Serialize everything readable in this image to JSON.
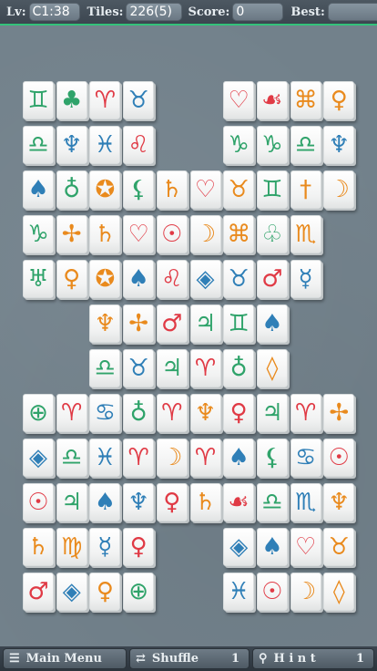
{
  "header": {
    "level_label": "Lv:",
    "level_value": "C1:38",
    "tiles_label": "Tiles:",
    "tiles_value": "226(5)",
    "score_label": "Score:",
    "score_value": "0",
    "best_label": "Best:",
    "best_value": ""
  },
  "footer": {
    "menu_label": "Main Menu",
    "shuffle_label": "Shuffle",
    "shuffle_count": "1",
    "hint_label": "H i n t",
    "hint_count": "1"
  },
  "icons": {
    "menu": "list-icon",
    "shuffle": "shuffle-icon",
    "hint": "magnifier-icon"
  },
  "colors": {
    "accent_bar": "#33c27a",
    "green": "#2fa36a",
    "blue": "#2f7fb7",
    "red": "#e03a45",
    "orange": "#e98a1d"
  },
  "tiles": [
    {
      "row": 0,
      "col": 0,
      "g": "♊",
      "c": "green"
    },
    {
      "row": 0,
      "col": 1,
      "g": "♣",
      "c": "green"
    },
    {
      "row": 0,
      "col": 2,
      "g": "♈",
      "c": "red"
    },
    {
      "row": 0,
      "col": 3,
      "g": "♉",
      "c": "blue"
    },
    {
      "row": 0,
      "col": 6,
      "g": "♡",
      "c": "red"
    },
    {
      "row": 0,
      "col": 7,
      "g": "☙",
      "c": "red"
    },
    {
      "row": 0,
      "col": 8,
      "g": "⌘",
      "c": "orange"
    },
    {
      "row": 0,
      "col": 9,
      "g": "♀",
      "c": "orange"
    },
    {
      "row": 1,
      "col": 0,
      "g": "♎",
      "c": "green"
    },
    {
      "row": 1,
      "col": 1,
      "g": "♆",
      "c": "blue"
    },
    {
      "row": 1,
      "col": 2,
      "g": "♓",
      "c": "blue"
    },
    {
      "row": 1,
      "col": 3,
      "g": "♌",
      "c": "red"
    },
    {
      "row": 1,
      "col": 6,
      "g": "♑",
      "c": "green"
    },
    {
      "row": 1,
      "col": 7,
      "g": "♑",
      "c": "green"
    },
    {
      "row": 1,
      "col": 8,
      "g": "♎",
      "c": "green"
    },
    {
      "row": 1,
      "col": 9,
      "g": "♆",
      "c": "blue"
    },
    {
      "row": 2,
      "col": 0,
      "g": "♠",
      "c": "blue"
    },
    {
      "row": 2,
      "col": 1,
      "g": "♁",
      "c": "green"
    },
    {
      "row": 2,
      "col": 2,
      "g": "✪",
      "c": "orange"
    },
    {
      "row": 2,
      "col": 3,
      "g": "⚸",
      "c": "green"
    },
    {
      "row": 2,
      "col": 4,
      "g": "♄",
      "c": "orange"
    },
    {
      "row": 2,
      "col": 5,
      "g": "♡",
      "c": "red"
    },
    {
      "row": 2,
      "col": 6,
      "g": "♉",
      "c": "orange"
    },
    {
      "row": 2,
      "col": 7,
      "g": "♊",
      "c": "green"
    },
    {
      "row": 2,
      "col": 8,
      "g": "†",
      "c": "orange"
    },
    {
      "row": 2,
      "col": 9,
      "g": "☽",
      "c": "orange"
    },
    {
      "row": 3,
      "col": 0,
      "g": "♑",
      "c": "green"
    },
    {
      "row": 3,
      "col": 1,
      "g": "✢",
      "c": "orange"
    },
    {
      "row": 3,
      "col": 2,
      "g": "♄",
      "c": "orange"
    },
    {
      "row": 3,
      "col": 3,
      "g": "♡",
      "c": "red"
    },
    {
      "row": 3,
      "col": 4,
      "g": "☉",
      "c": "red"
    },
    {
      "row": 3,
      "col": 5,
      "g": "☽",
      "c": "orange"
    },
    {
      "row": 3,
      "col": 6,
      "g": "⌘",
      "c": "orange"
    },
    {
      "row": 3,
      "col": 7,
      "g": "♧",
      "c": "green"
    },
    {
      "row": 3,
      "col": 8,
      "g": "♏",
      "c": "orange"
    },
    {
      "row": 4,
      "col": 0,
      "g": "♅",
      "c": "green"
    },
    {
      "row": 4,
      "col": 1,
      "g": "♀",
      "c": "orange"
    },
    {
      "row": 4,
      "col": 2,
      "g": "✪",
      "c": "orange"
    },
    {
      "row": 4,
      "col": 3,
      "g": "♠",
      "c": "blue"
    },
    {
      "row": 4,
      "col": 4,
      "g": "♌",
      "c": "red"
    },
    {
      "row": 4,
      "col": 5,
      "g": "◈",
      "c": "blue"
    },
    {
      "row": 4,
      "col": 6,
      "g": "♉",
      "c": "blue"
    },
    {
      "row": 4,
      "col": 7,
      "g": "♂",
      "c": "red"
    },
    {
      "row": 4,
      "col": 8,
      "g": "☿",
      "c": "blue"
    },
    {
      "row": 5,
      "col": 2,
      "g": "♆",
      "c": "orange"
    },
    {
      "row": 5,
      "col": 3,
      "g": "✢",
      "c": "orange"
    },
    {
      "row": 5,
      "col": 4,
      "g": "♂",
      "c": "red"
    },
    {
      "row": 5,
      "col": 5,
      "g": "♃",
      "c": "green"
    },
    {
      "row": 5,
      "col": 6,
      "g": "♊",
      "c": "green"
    },
    {
      "row": 5,
      "col": 7,
      "g": "♠",
      "c": "blue"
    },
    {
      "row": 6,
      "col": 2,
      "g": "♎",
      "c": "green"
    },
    {
      "row": 6,
      "col": 3,
      "g": "♉",
      "c": "blue"
    },
    {
      "row": 6,
      "col": 4,
      "g": "♃",
      "c": "green"
    },
    {
      "row": 6,
      "col": 5,
      "g": "♈",
      "c": "red"
    },
    {
      "row": 6,
      "col": 6,
      "g": "♁",
      "c": "green"
    },
    {
      "row": 6,
      "col": 7,
      "g": "◊",
      "c": "orange"
    },
    {
      "row": 7,
      "col": 0,
      "g": "⊕",
      "c": "green"
    },
    {
      "row": 7,
      "col": 1,
      "g": "♈",
      "c": "red"
    },
    {
      "row": 7,
      "col": 2,
      "g": "♋",
      "c": "blue"
    },
    {
      "row": 7,
      "col": 3,
      "g": "♁",
      "c": "green"
    },
    {
      "row": 7,
      "col": 4,
      "g": "♈",
      "c": "red"
    },
    {
      "row": 7,
      "col": 5,
      "g": "♆",
      "c": "orange"
    },
    {
      "row": 7,
      "col": 6,
      "g": "♀",
      "c": "red"
    },
    {
      "row": 7,
      "col": 7,
      "g": "♃",
      "c": "green"
    },
    {
      "row": 7,
      "col": 8,
      "g": "♈",
      "c": "red"
    },
    {
      "row": 7,
      "col": 9,
      "g": "✢",
      "c": "orange"
    },
    {
      "row": 8,
      "col": 0,
      "g": "◈",
      "c": "blue"
    },
    {
      "row": 8,
      "col": 1,
      "g": "♎",
      "c": "green"
    },
    {
      "row": 8,
      "col": 2,
      "g": "♓",
      "c": "blue"
    },
    {
      "row": 8,
      "col": 3,
      "g": "♈",
      "c": "red"
    },
    {
      "row": 8,
      "col": 4,
      "g": "☽",
      "c": "orange"
    },
    {
      "row": 8,
      "col": 5,
      "g": "♈",
      "c": "red"
    },
    {
      "row": 8,
      "col": 6,
      "g": "♠",
      "c": "blue"
    },
    {
      "row": 8,
      "col": 7,
      "g": "⚸",
      "c": "green"
    },
    {
      "row": 8,
      "col": 8,
      "g": "♋",
      "c": "blue"
    },
    {
      "row": 8,
      "col": 9,
      "g": "☉",
      "c": "red"
    },
    {
      "row": 9,
      "col": 0,
      "g": "☉",
      "c": "red"
    },
    {
      "row": 9,
      "col": 1,
      "g": "♃",
      "c": "green"
    },
    {
      "row": 9,
      "col": 2,
      "g": "♠",
      "c": "blue"
    },
    {
      "row": 9,
      "col": 3,
      "g": "♆",
      "c": "blue"
    },
    {
      "row": 9,
      "col": 4,
      "g": "♀",
      "c": "red"
    },
    {
      "row": 9,
      "col": 5,
      "g": "♄",
      "c": "orange"
    },
    {
      "row": 9,
      "col": 6,
      "g": "☙",
      "c": "red"
    },
    {
      "row": 9,
      "col": 7,
      "g": "♎",
      "c": "green"
    },
    {
      "row": 9,
      "col": 8,
      "g": "♏",
      "c": "blue"
    },
    {
      "row": 9,
      "col": 9,
      "g": "♆",
      "c": "orange"
    },
    {
      "row": 10,
      "col": 0,
      "g": "♄",
      "c": "orange"
    },
    {
      "row": 10,
      "col": 1,
      "g": "♍",
      "c": "orange"
    },
    {
      "row": 10,
      "col": 2,
      "g": "☿",
      "c": "blue"
    },
    {
      "row": 10,
      "col": 3,
      "g": "♀",
      "c": "red"
    },
    {
      "row": 10,
      "col": 6,
      "g": "◈",
      "c": "blue"
    },
    {
      "row": 10,
      "col": 7,
      "g": "♠",
      "c": "blue"
    },
    {
      "row": 10,
      "col": 8,
      "g": "♡",
      "c": "red"
    },
    {
      "row": 10,
      "col": 9,
      "g": "♉",
      "c": "orange"
    },
    {
      "row": 11,
      "col": 0,
      "g": "♂",
      "c": "red"
    },
    {
      "row": 11,
      "col": 1,
      "g": "◈",
      "c": "blue"
    },
    {
      "row": 11,
      "col": 2,
      "g": "♀",
      "c": "orange"
    },
    {
      "row": 11,
      "col": 3,
      "g": "⊕",
      "c": "green"
    },
    {
      "row": 11,
      "col": 6,
      "g": "♓",
      "c": "blue"
    },
    {
      "row": 11,
      "col": 7,
      "g": "☉",
      "c": "red"
    },
    {
      "row": 11,
      "col": 8,
      "g": "☽",
      "c": "orange"
    },
    {
      "row": 11,
      "col": 9,
      "g": "◊",
      "c": "orange"
    }
  ]
}
